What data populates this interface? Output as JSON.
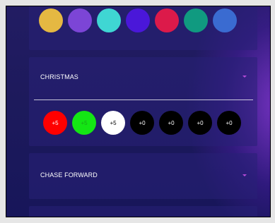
{
  "swatches": [
    {
      "name": "yellow",
      "color": "#e5b842"
    },
    {
      "name": "violet",
      "color": "#7c45d6"
    },
    {
      "name": "turquoise",
      "color": "#3fd6d3"
    },
    {
      "name": "indigo",
      "color": "#4a17d9"
    },
    {
      "name": "crimson",
      "color": "#dc1a4a"
    },
    {
      "name": "teal",
      "color": "#109a80"
    },
    {
      "name": "blue",
      "color": "#3a6bd1"
    }
  ],
  "christmas": {
    "label": "CHRISTMAS",
    "steps": [
      {
        "label": "+5",
        "color": "#ff0000"
      },
      {
        "label": "+5",
        "color": "#14e614"
      },
      {
        "label": "+5",
        "color": "#ffffff"
      },
      {
        "label": "+0",
        "color": "#000000"
      },
      {
        "label": "+0",
        "color": "#000000"
      },
      {
        "label": "+0",
        "color": "#000000"
      },
      {
        "label": "+0",
        "color": "#000000"
      }
    ]
  },
  "chase_forward": {
    "label": "CHASE FORWARD"
  },
  "colors": {
    "accent_caret": "#b44ad6"
  }
}
